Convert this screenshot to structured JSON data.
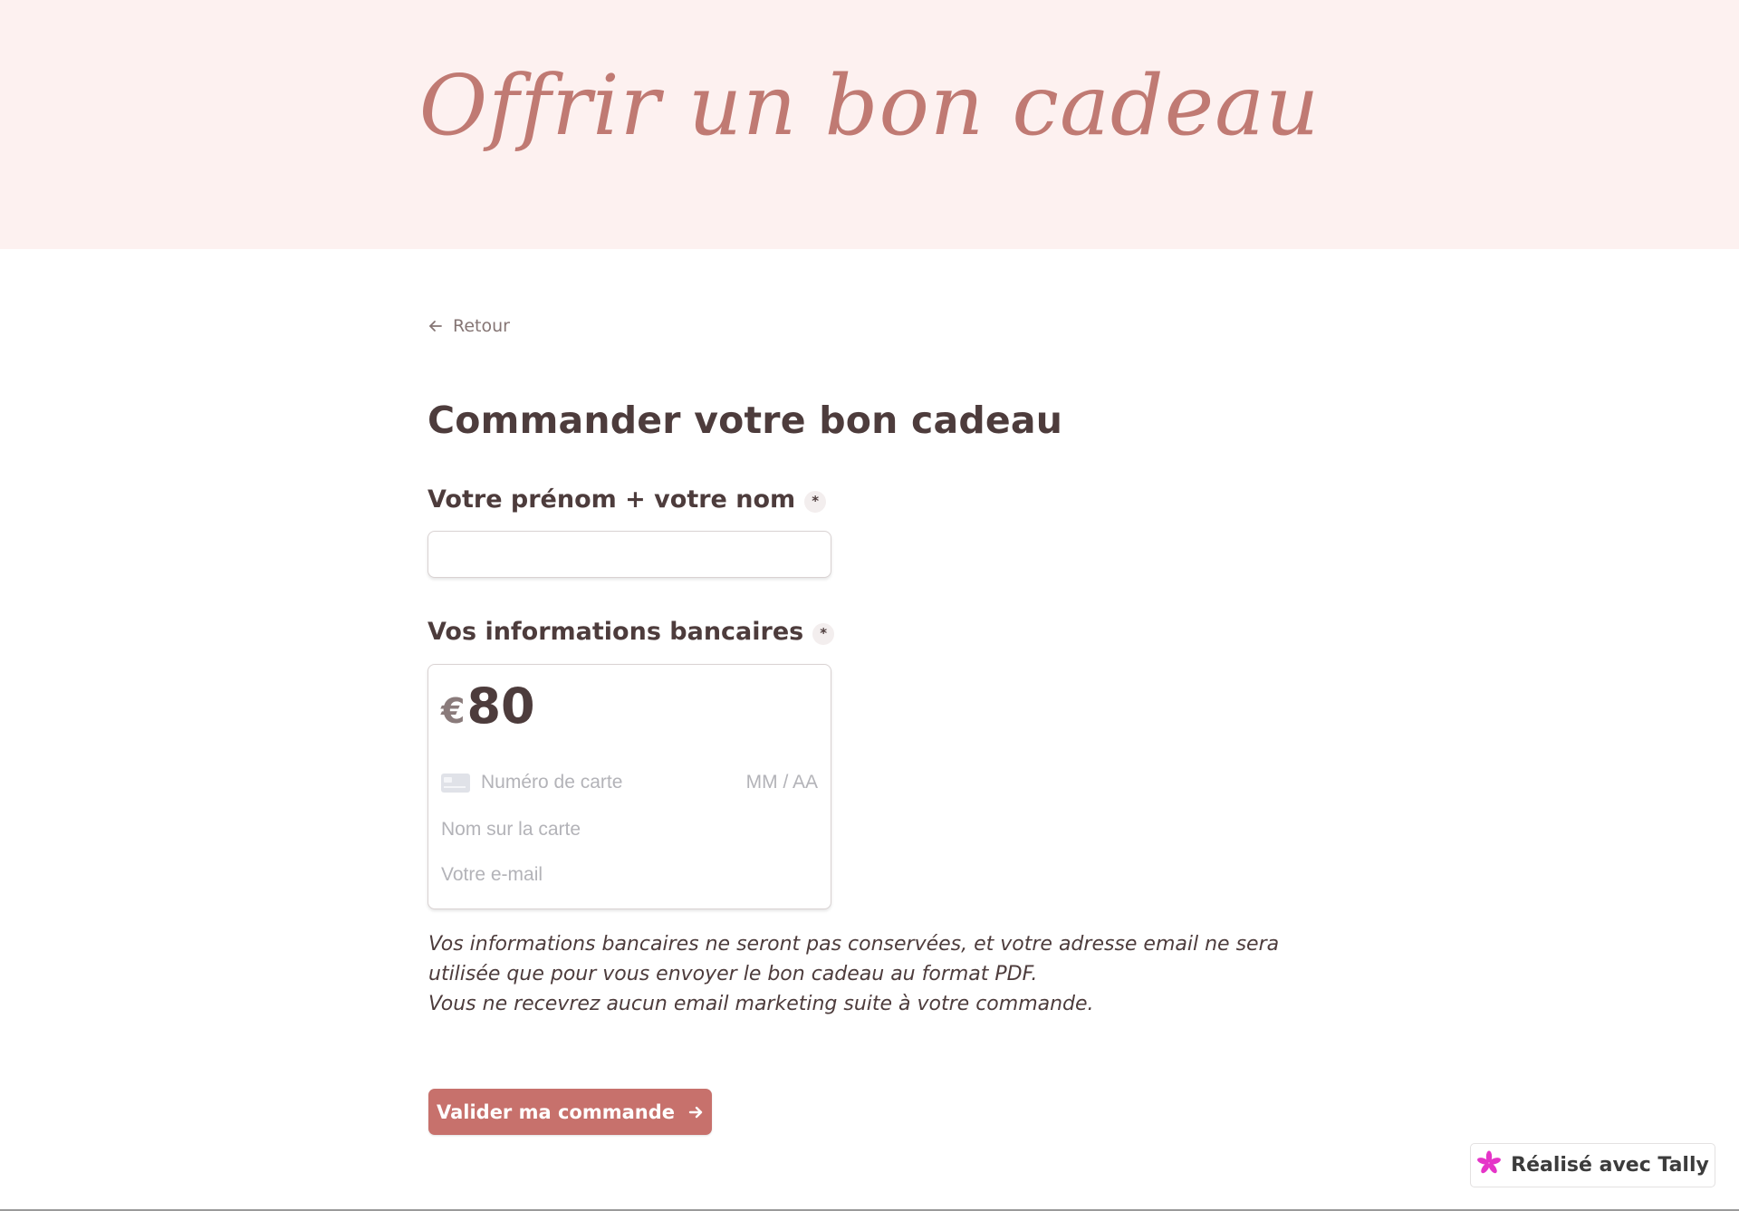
{
  "hero": {
    "title": "Offrir un bon cadeau"
  },
  "nav": {
    "back_label": "Retour"
  },
  "form": {
    "title": "Commander votre bon cadeau",
    "name_field": {
      "label": "Votre prénom + votre nom",
      "required_mark": "*",
      "value": "",
      "placeholder": ""
    },
    "payment_field": {
      "label": "Vos informations bancaires",
      "required_mark": "*",
      "currency": "€",
      "amount": "80",
      "card_number_placeholder": "Numéro de carte",
      "card_expiry_placeholder": "MM / AA",
      "card_name_placeholder": "Nom sur la carte",
      "email_placeholder": "Votre e-mail"
    },
    "disclaimer": [
      "Vos informations bancaires ne seront pas conservées, et votre adresse email ne sera utilisée que pour vous envoyer le bon cadeau au format PDF.",
      "Vous ne recevrez aucun email marketing suite à votre commande."
    ],
    "submit_label": "Valider ma commande"
  },
  "badge": {
    "label": "Réalisé avec Tally",
    "icon": "tally-asterisk-icon",
    "icon_color": "#e535c8"
  },
  "colors": {
    "hero_bg": "#fdf1f0",
    "accent": "#c7716c",
    "title_script": "#c07a73",
    "text": "#4d3c3c"
  }
}
